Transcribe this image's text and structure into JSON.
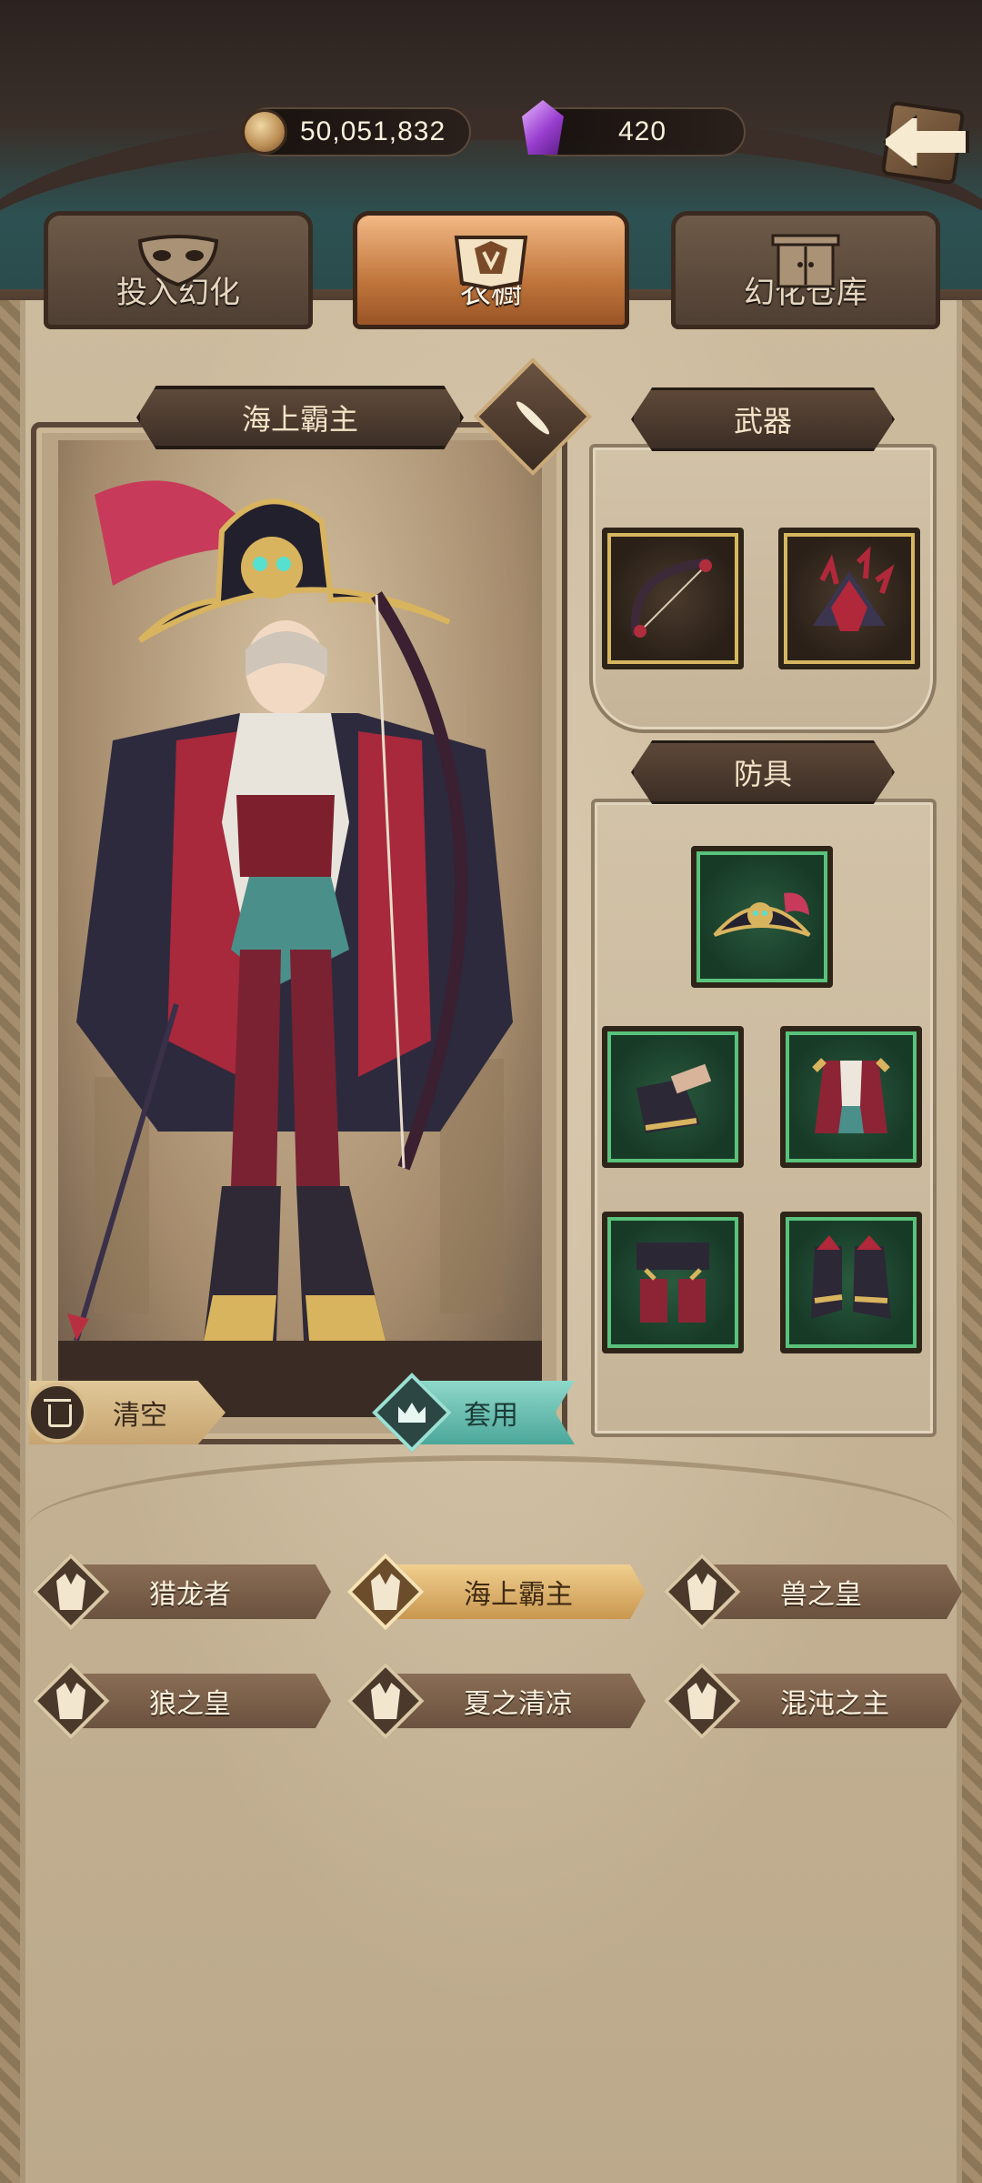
{
  "currency": {
    "gold": "50,051,832",
    "gems": "420"
  },
  "tabs": [
    {
      "label": "投入幻化",
      "icon": "mask-icon",
      "selected": false
    },
    {
      "label": "衣橱",
      "icon": "wardrobe-crest-icon",
      "selected": true
    },
    {
      "label": "幻化仓库",
      "icon": "cabinet-icon",
      "selected": false
    }
  ],
  "preview": {
    "title": "海上霸主",
    "clear_label": "清空",
    "apply_label": "套用"
  },
  "weapons": {
    "title": "武器",
    "slots": [
      {
        "icon": "bow-icon",
        "rarity": "gold"
      },
      {
        "icon": "spiked-quiver-icon",
        "rarity": "gold"
      }
    ]
  },
  "armor": {
    "title": "防具",
    "slots": [
      {
        "icon": "pirate-hat-icon",
        "rarity": "green"
      },
      {
        "icon": "gauntlets-icon",
        "rarity": "green"
      },
      {
        "icon": "coat-icon",
        "rarity": "green"
      },
      {
        "icon": "leggings-icon",
        "rarity": "green"
      },
      {
        "icon": "boots-icon",
        "rarity": "green"
      }
    ]
  },
  "outfits": [
    {
      "name": "猎龙者",
      "selected": false
    },
    {
      "name": "海上霸主",
      "selected": true
    },
    {
      "name": "兽之皇",
      "selected": false
    },
    {
      "name": "狼之皇",
      "selected": false
    },
    {
      "name": "夏之清凉",
      "selected": false
    },
    {
      "name": "混沌之主",
      "selected": false
    }
  ],
  "colors": {
    "selected_tab": "#c0763c",
    "apply_button": "#4ba79a",
    "gold_frame": "#d7b660",
    "green_frame": "#59c27b"
  }
}
